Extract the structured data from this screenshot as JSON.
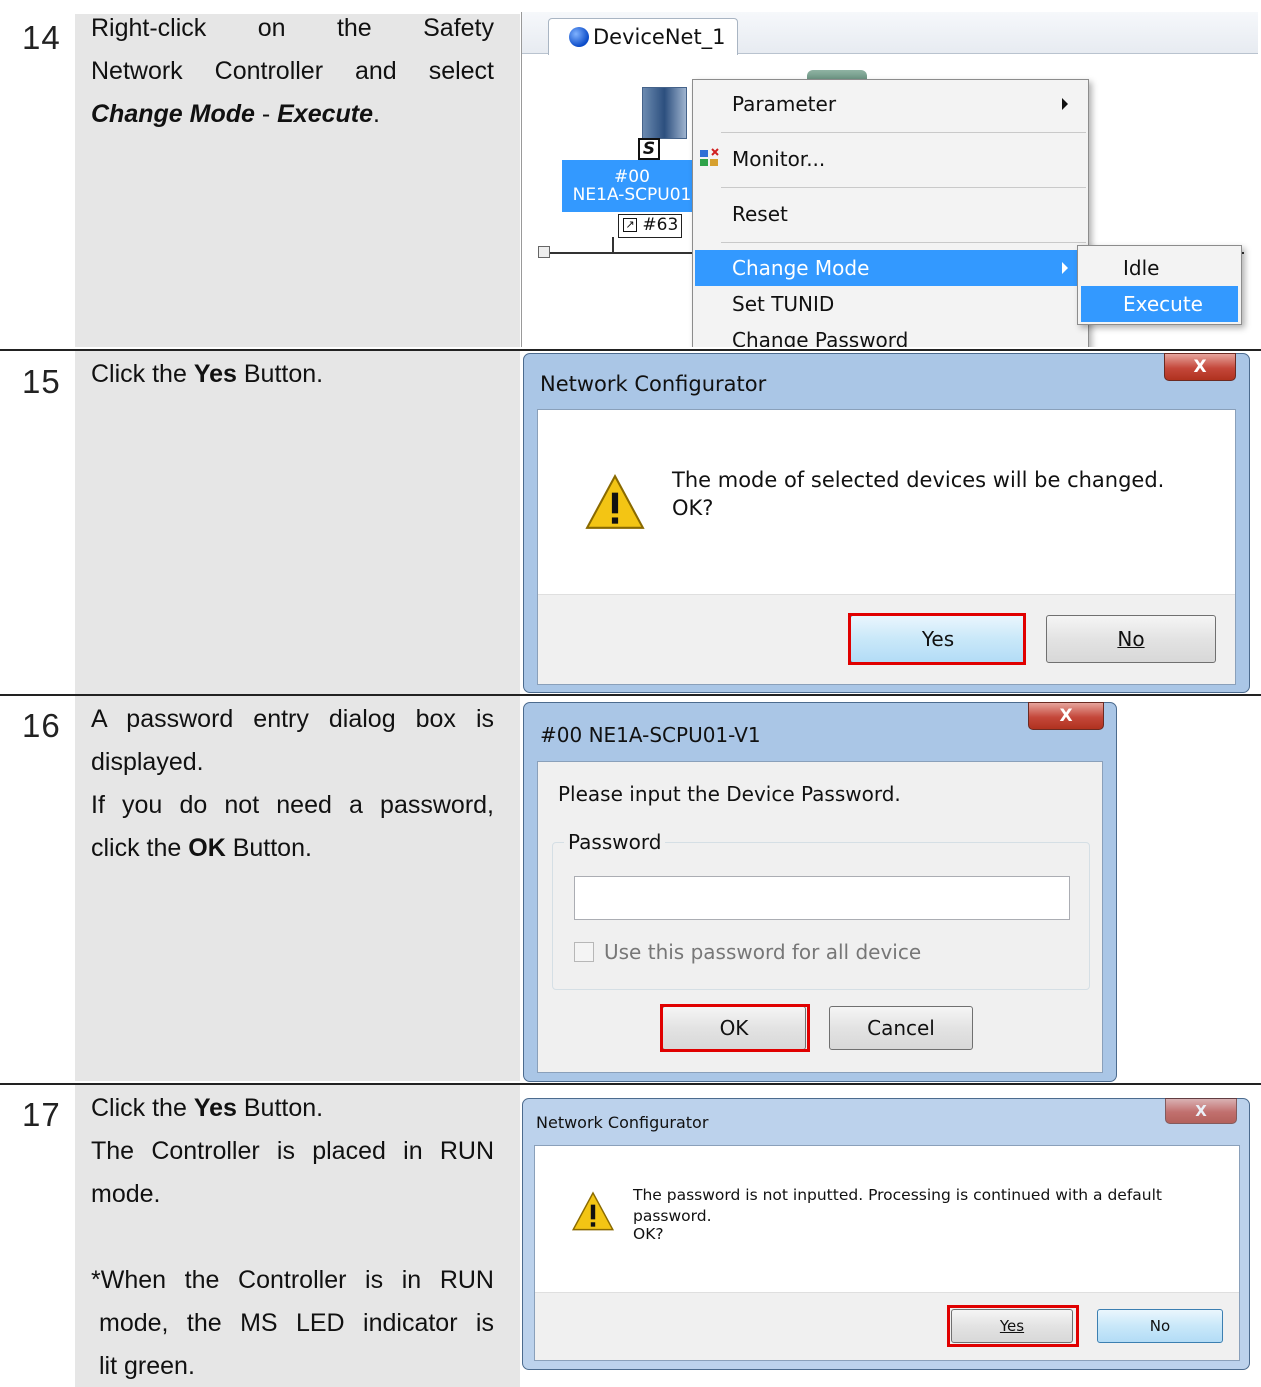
{
  "steps": [
    {
      "number": "14",
      "text_line1": "Right-click on the Safety",
      "text_line2": "Network Controller and select",
      "text_change_mode": "Change Mode",
      "text_dash": " - ",
      "text_execute": "Execute",
      "text_period": "."
    },
    {
      "number": "15",
      "text_before": "Click the ",
      "text_bold": "Yes",
      "text_after": " Button."
    },
    {
      "number": "16",
      "text_line1": "A password entry dialog box is",
      "text_line2": "displayed.",
      "text_line3": "If you do not need a password,",
      "text_before": "click the ",
      "text_bold": "OK",
      "text_after": " Button."
    },
    {
      "number": "17",
      "text_before": "Click the ",
      "text_bold": "Yes",
      "text_after": " Button.",
      "text_line2": "The Controller is placed in RUN",
      "text_line3": "mode.",
      "note_line1": "*When the Controller is in RUN",
      "note_line2": "mode, the MS LED indicator is",
      "note_line3": "lit green."
    }
  ],
  "screen14": {
    "tab_label": "DeviceNet_1",
    "node_address": "#00",
    "node_model": "NE1A-SCPU01",
    "node_badge": "S",
    "node_link": "#63",
    "menu_items": [
      "Parameter",
      "Monitor...",
      "Reset",
      "Change Mode",
      "Set TUNID",
      "Change Password"
    ],
    "submenu_items": [
      "Idle",
      "Execute"
    ],
    "icons": [
      "network-icon",
      "monitor-icon",
      "submenu-arrow-icon"
    ]
  },
  "dialog15": {
    "title": "Network Configurator",
    "close_label": "X",
    "message_line1": "The mode of selected devices will be changed.",
    "message_line2": "OK?",
    "yes_label": "Yes",
    "no_label": "No",
    "icon": "warning-icon"
  },
  "dialog16": {
    "title": "#00 NE1A-SCPU01-V1",
    "close_label": "X",
    "prompt": "Please input the Device Password.",
    "group_label": "Password",
    "password_value": "",
    "checkbox_label": "Use this password for all device",
    "checkbox_checked": false,
    "ok_label": "OK",
    "cancel_label": "Cancel"
  },
  "dialog17": {
    "title": "Network Configurator",
    "close_label": "X",
    "message_line1": "The password is not inputted. Processing is continued with a default",
    "message_line2": "password.",
    "message_line3": "OK?",
    "yes_label": "Yes",
    "no_label": "No",
    "icon": "warning-icon"
  },
  "colors": {
    "highlight": "#e00000",
    "menu_selection": "#3399ff",
    "step_background": "#e6e6e6"
  }
}
